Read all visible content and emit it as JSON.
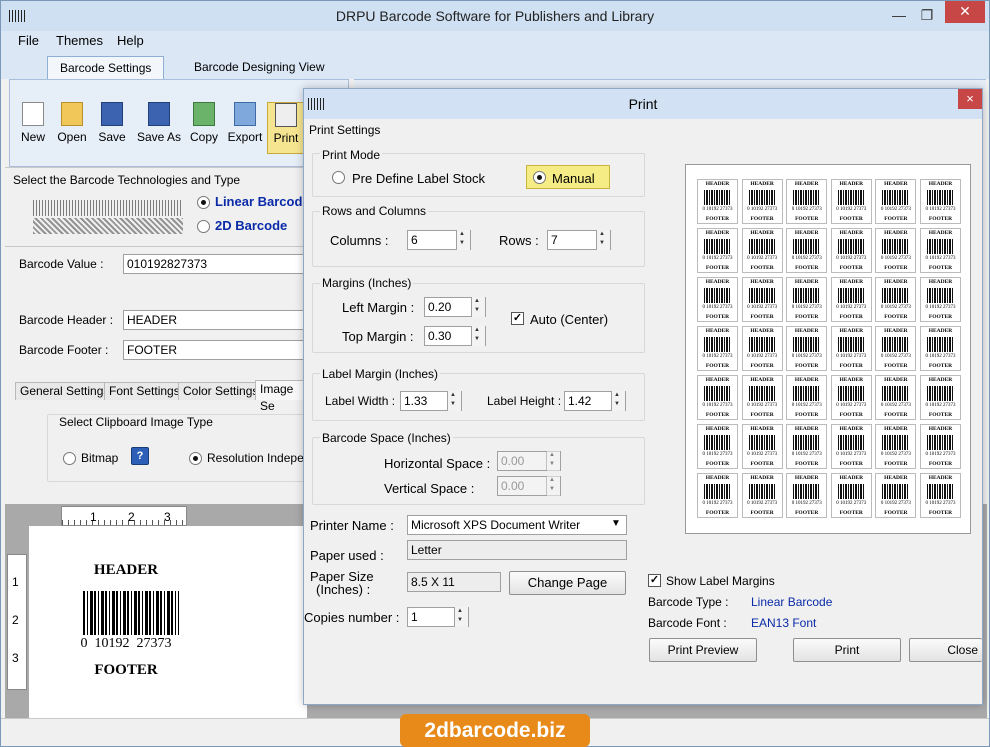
{
  "app": {
    "title": "DRPU Barcode Software for Publishers and Library",
    "menu": [
      "File",
      "Themes",
      "Help"
    ],
    "tabs": [
      "Barcode Settings",
      "Barcode Designing View"
    ]
  },
  "toolbar": [
    "New",
    "Open",
    "Save",
    "Save As",
    "Copy",
    "Export",
    "Print"
  ],
  "left_panel": {
    "tech_label": "Select the Barcode Technologies and Type",
    "linear_label": "Linear Barcode",
    "twod_label": "2D Barcode",
    "barcode_value_label": "Barcode Value :",
    "barcode_value": "010192827373",
    "header_label": "Barcode Header :",
    "header_value": "HEADER",
    "footer_label": "Barcode Footer :",
    "footer_value": "FOOTER",
    "subtabs": [
      "General Settings",
      "Font Settings",
      "Color Settings",
      "Image Se"
    ],
    "clipboard_label": "Select Clipboard Image Type",
    "bitmap_label": "Bitmap",
    "resolution_label": "Resolution Independ"
  },
  "design_view": {
    "ruler_h": [
      "1",
      "2",
      "3"
    ],
    "ruler_v": [
      "1",
      "2",
      "3"
    ],
    "header": "HEADER",
    "number": "0  10192  27373",
    "footer": "FOOTER"
  },
  "dialog": {
    "title": "Print",
    "close": "×",
    "print_settings": "Print Settings",
    "print_mode": "Print Mode",
    "predefine_label": "Pre Define Label Stock",
    "manual_label": "Manual",
    "rows_cols_title": "Rows and Columns",
    "columns_label": "Columns :",
    "columns": "6",
    "rows_label": "Rows :",
    "rows": "7",
    "margins_title": "Margins (Inches)",
    "left_margin_label": "Left Margin :",
    "left_margin": "0.20",
    "top_margin_label": "Top Margin :",
    "top_margin": "0.30",
    "auto_center_label": "Auto (Center)",
    "label_margin_title": "Label Margin (Inches)",
    "label_width_label": "Label Width :",
    "label_width": "1.33",
    "label_height_label": "Label Height :",
    "label_height": "1.42",
    "barcode_space_title": "Barcode Space (Inches)",
    "horizontal_space_label": "Horizontal Space :",
    "horizontal_space": "0.00",
    "vertical_space_label": "Vertical Space :",
    "vertical_space": "0.00",
    "printer_name_label": "Printer Name :",
    "printer_name": "Microsoft XPS Document Writer",
    "paper_used_label": "Paper used :",
    "paper_used": "Letter",
    "paper_size_label1": "Paper Size",
    "paper_size_label2": "(Inches) :",
    "paper_size": "8.5 X 11",
    "change_page": "Change Page",
    "copies_label": "Copies number :",
    "copies": "1",
    "show_margins_label": "Show Label Margins",
    "barcode_type_label": "Barcode Type :",
    "barcode_type": "Linear Barcode",
    "barcode_font_label": "Barcode Font :",
    "barcode_font": "EAN13 Font",
    "print_preview": "Print Preview",
    "print": "Print",
    "close_btn": "Close"
  },
  "preview_label": {
    "header": "HEADER",
    "number": "0 10192 27373",
    "footer": "FOOTER"
  },
  "preview_grid": {
    "columns": 6,
    "rows": 7
  },
  "watermark": "2dbarcode.biz",
  "colors": {
    "accent_blue": "#0a2aa8",
    "manual_highlight": "#f6ec86",
    "watermark": "#e88a1a"
  }
}
